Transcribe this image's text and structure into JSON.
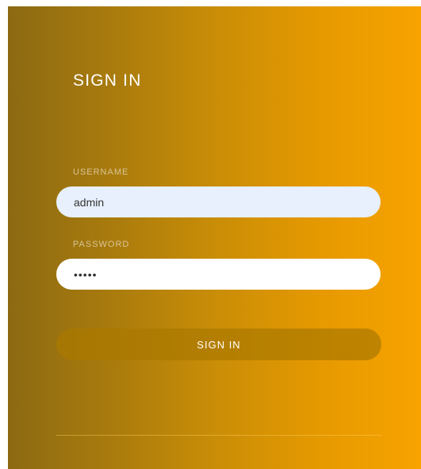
{
  "login": {
    "title": "SIGN IN",
    "username_label": "USERNAME",
    "username_value": "admin",
    "password_label": "PASSWORD",
    "password_value": "•••••",
    "button_label": "SIGN IN"
  },
  "colors": {
    "gradient_start": "#8c6a12",
    "gradient_end": "#f8a300",
    "button_fill": "#b88700",
    "label_color": "#d9c497"
  }
}
